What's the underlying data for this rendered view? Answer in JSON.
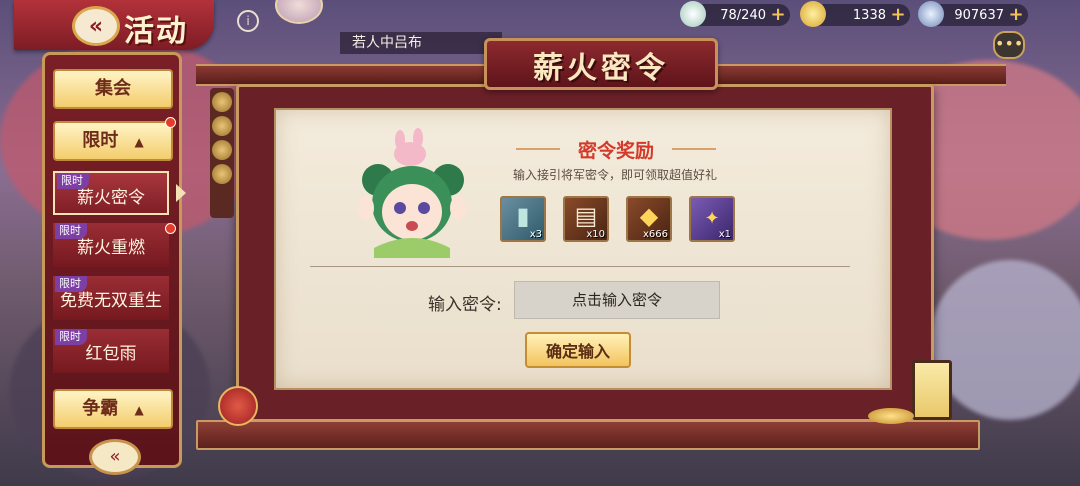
{
  "header": {
    "back_icon": "double-chevron-left-icon",
    "title": "活动",
    "player_name": "若人中吕布",
    "resources": [
      {
        "name": "stamina",
        "icon": "jade-disc-icon",
        "value": "78/240"
      },
      {
        "name": "gold",
        "icon": "gold-ingot-icon",
        "value": "1338"
      },
      {
        "name": "silver",
        "icon": "silver-coin-icon",
        "value": "907637"
      }
    ],
    "chat_icon": "chat-bubble-icon"
  },
  "banner": {
    "title": "薪火密令"
  },
  "sidebar": {
    "tag_label": "限时",
    "groups": [
      {
        "label": "集会"
      },
      {
        "label": "限时",
        "caret": "▲"
      },
      {
        "label": "争霸",
        "caret": "▲"
      }
    ],
    "items": [
      {
        "label": "薪火密令"
      },
      {
        "label": "薪火重燃"
      },
      {
        "label": "免费无双重生"
      },
      {
        "label": "红包雨"
      }
    ]
  },
  "panel": {
    "reward_title": "密令奖励",
    "reward_desc": "输入接引将军密令，即可领取超值好礼",
    "rewards": [
      {
        "name": "token-card",
        "icon": "jade-card-icon",
        "qty": "x3"
      },
      {
        "name": "scroll",
        "icon": "scroll-icon",
        "qty": "x10"
      },
      {
        "name": "gold-ingot",
        "icon": "gold-ingot-icon",
        "qty": "x666"
      },
      {
        "name": "badge",
        "icon": "purple-badge-icon",
        "qty": "x1"
      }
    ],
    "code_label": "输入密令:",
    "code_placeholder": "点击输入密令",
    "confirm_label": "确定输入"
  },
  "colors": {
    "primary_red": "#7a1f27",
    "gold_border": "#c99b62",
    "reward_title": "#d43a2b",
    "limited_tag": "#7e3fa5",
    "button_gold": "#f2c45e"
  }
}
